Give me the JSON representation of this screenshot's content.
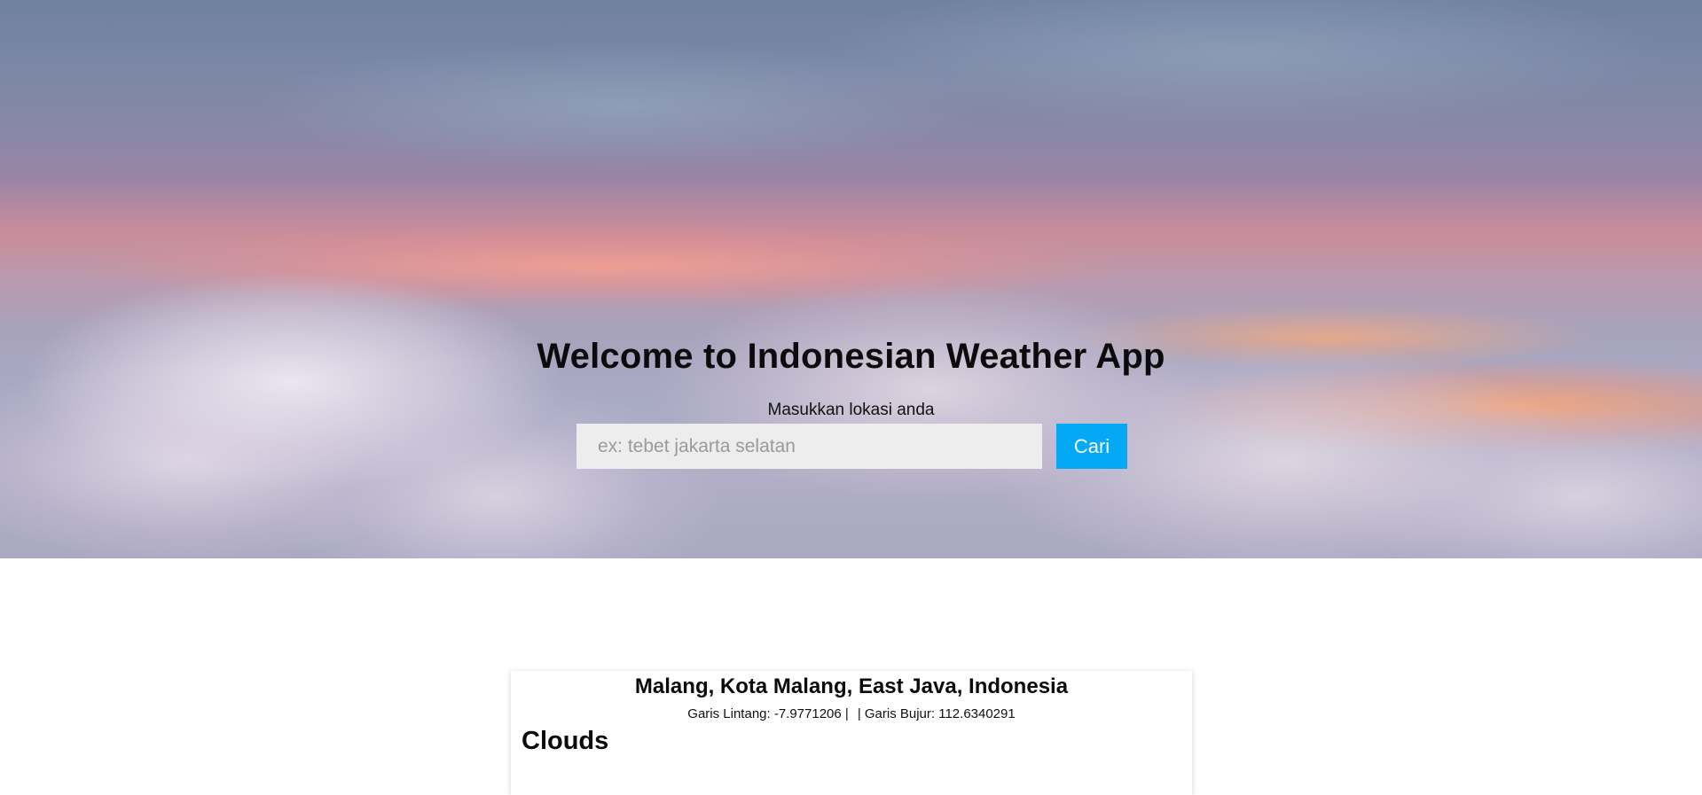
{
  "hero": {
    "title": "Welcome to Indonesian Weather App",
    "prompt_label": "Masukkan lokasi anda",
    "search_placeholder": "ex: tebet jakarta selatan",
    "search_value": "",
    "search_button_label": "Cari",
    "colors": {
      "button": "#03a9f4",
      "input_background": "#ededed"
    }
  },
  "result": {
    "location": "Malang, Kota Malang, East Java, Indonesia",
    "latitude_text": "Garis Lintang: -7.9771206 |",
    "longitude_text": "| Garis Bujur: 112.6340291",
    "condition": "Clouds"
  }
}
